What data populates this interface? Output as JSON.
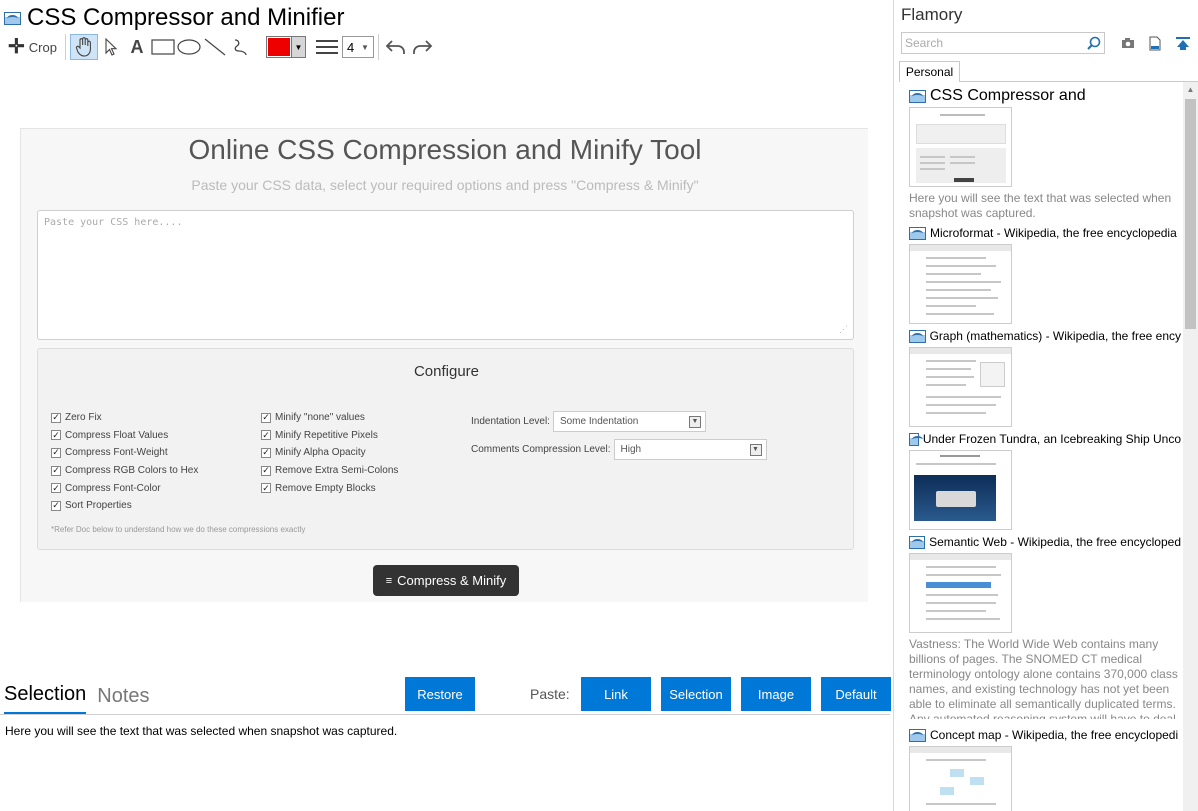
{
  "document": {
    "title": "CSS Compressor and Minifier"
  },
  "toolbar": {
    "crop_label": "Crop",
    "tools": [
      "hand-icon",
      "pointer-icon",
      "text-icon",
      "rectangle-icon",
      "ellipse-icon",
      "line-icon",
      "freehand-icon"
    ],
    "color": "#ee0000",
    "line_width": "4"
  },
  "snapshot": {
    "title": "Online CSS Compression and Minify Tool",
    "subtitle": "Paste your CSS data, select your required options and press \"Compress & Minify\"",
    "textarea_placeholder": "Paste your CSS here....",
    "configure_title": "Configure",
    "options_col1": [
      "Zero Fix",
      "Compress Float Values",
      "Compress Font-Weight",
      "Compress RGB Colors to Hex",
      "Compress Font-Color",
      "Sort Properties"
    ],
    "options_col2": [
      "Minify \"none\" values",
      "Minify Repetitive Pixels",
      "Minify Alpha Opacity",
      "Remove Extra Semi-Colons",
      "Remove Empty Blocks"
    ],
    "indentation_label": "Indentation Level:",
    "indentation_value": "Some Indentation",
    "comments_label": "Comments Compression Level:",
    "comments_value": "High",
    "refer_note": "*Refer Doc below to understand how we do these compressions exactly",
    "compress_button": "Compress & Minify"
  },
  "bottom": {
    "tab_selection": "Selection",
    "tab_notes": "Notes",
    "restore_button": "Restore",
    "paste_label": "Paste:",
    "paste_buttons": [
      "Link",
      "Selection",
      "Image",
      "Default"
    ],
    "selection_text": "Here you will see the text that was selected when snapshot was captured."
  },
  "sidebar": {
    "brand": "Flamory",
    "search_placeholder": "Search",
    "tab_personal": "Personal",
    "entries": [
      {
        "title": "CSS Compressor and",
        "snippet": "Here you will see the text that was selected when snapshot was captured."
      },
      {
        "title": "Microformat - Wikipedia, the free encyclopedia",
        "snippet": ""
      },
      {
        "title": "Graph (mathematics) - Wikipedia, the free ency",
        "snippet": ""
      },
      {
        "title": "Under Frozen Tundra, an Icebreaking Ship Unco",
        "snippet": ""
      },
      {
        "title": "Semantic Web - Wikipedia, the free encycloped",
        "snippet": "Vastness: The World Wide Web contains many billions of pages. The SNOMED CT medical terminology ontology alone contains 370,000 class names, and existing technology has not yet been able to eliminate all semantically duplicated terms. Any automated reasoning system will have to deal with truly huge inputs."
      },
      {
        "title": "Concept map - Wikipedia, the free encyclopedi",
        "snippet": ""
      }
    ]
  },
  "colors": {
    "accent": "#0078d7",
    "dark_button": "#333333",
    "pen_color": "#ee0000"
  }
}
